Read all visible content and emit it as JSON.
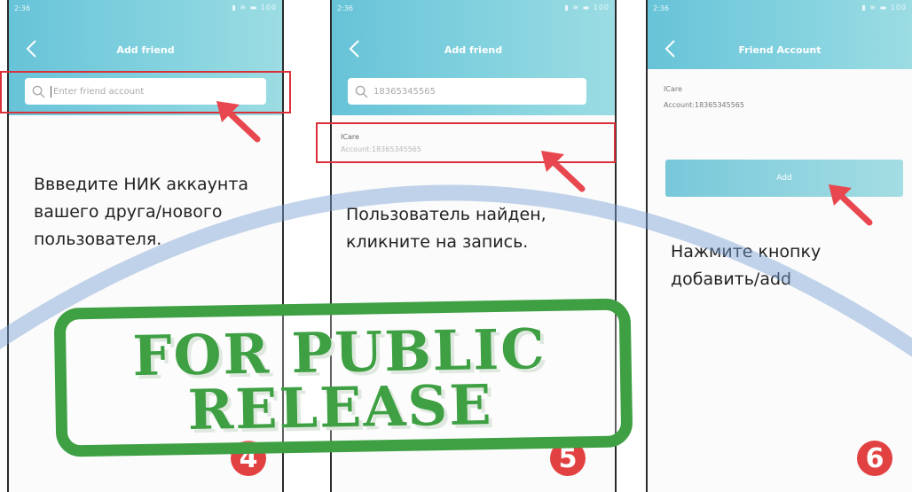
{
  "screens": [
    {
      "status_time": "2:36",
      "status_icons": "▮ ≋ ▬ 100",
      "title": "Add friend",
      "search_placeholder": "Enter friend account",
      "instruction": "Ввведите НИК аккаунта вашего друга/нового пользователя.",
      "step": "4"
    },
    {
      "status_time": "2:36",
      "status_icons": "▮ ≋ ▬ 100",
      "title": "Add friend",
      "search_value": "18365345565",
      "result_name": "ICare",
      "result_account": "Account:18365345565",
      "instruction": "Пользователь найден, кликните на запись.",
      "step": "5"
    },
    {
      "status_time": "2:36",
      "status_icons": "▮ ≋ ▬ 100",
      "title": "Friend Account",
      "account_name": "ICare",
      "account_number": "Account:18365345565",
      "add_label": "Add",
      "instruction": "Нажмите кнопку добавить/add",
      "step": "6"
    }
  ],
  "stamp_text": [
    "FOR PUBLIC",
    "RELEASE"
  ],
  "colors": {
    "appbar": "#67c3d8",
    "highlight": "#d9303a",
    "stamp": "#3ea043",
    "step_badge": "#e24141"
  }
}
